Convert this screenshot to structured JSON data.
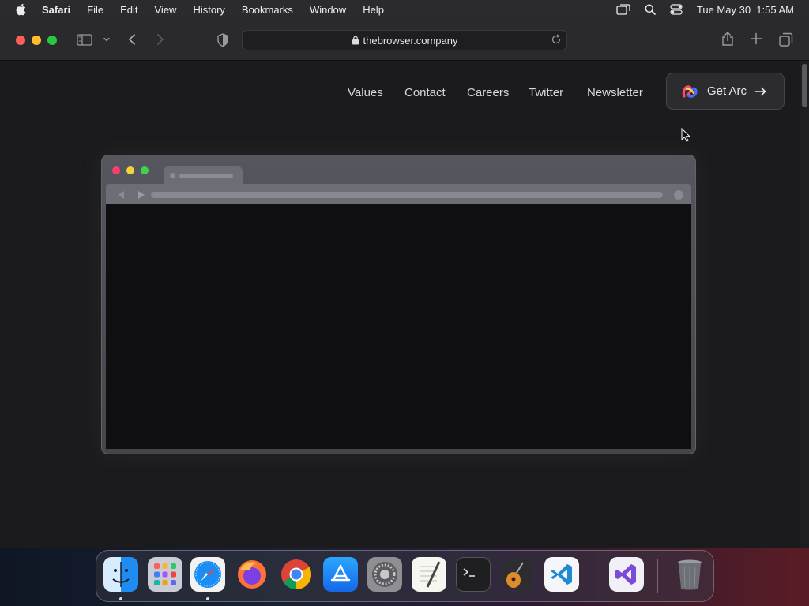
{
  "menubar": {
    "app_name": "Safari",
    "items": [
      "File",
      "Edit",
      "View",
      "History",
      "Bookmarks",
      "Window",
      "Help"
    ],
    "clock": "Tue May 30  1:55 AM"
  },
  "toolbar": {
    "url": "thebrowser.company"
  },
  "page": {
    "nav": [
      "Values",
      "Contact",
      "Careers",
      "Twitter",
      "Newsletter"
    ],
    "cta_label": "Get Arc"
  },
  "dock": {
    "apps": [
      "Finder",
      "Launchpad",
      "Safari",
      "Firefox",
      "Chrome",
      "App Store",
      "System Settings",
      "TextEdit",
      "Terminal",
      "GarageBand",
      "Visual Studio Code",
      "Visual Studio",
      "Trash"
    ]
  },
  "colors": {
    "close": "#fe5f57",
    "minimize": "#febc2e",
    "zoom": "#28c840",
    "page_bg": "#1b1b1d"
  }
}
